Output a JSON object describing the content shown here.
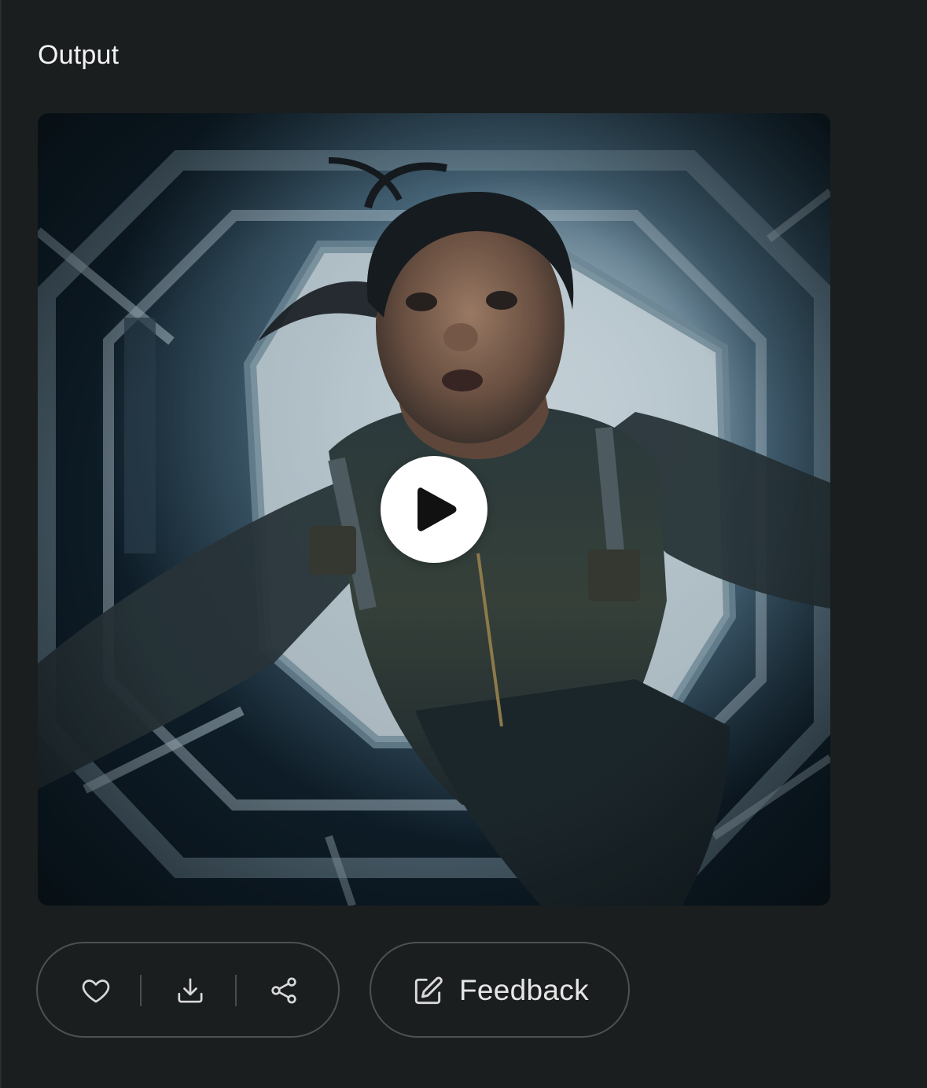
{
  "output": {
    "title": "Output"
  },
  "media": {
    "type": "video",
    "play_icon": "play-icon"
  },
  "actions": {
    "like_icon": "heart-icon",
    "download_icon": "download-icon",
    "share_icon": "share-icon"
  },
  "feedback": {
    "label": "Feedback",
    "icon": "edit-icon"
  },
  "colors": {
    "background": "#1b1e1f",
    "text": "#f2f2f2",
    "border": "#4d5154",
    "icon": "#d9d9d9"
  }
}
